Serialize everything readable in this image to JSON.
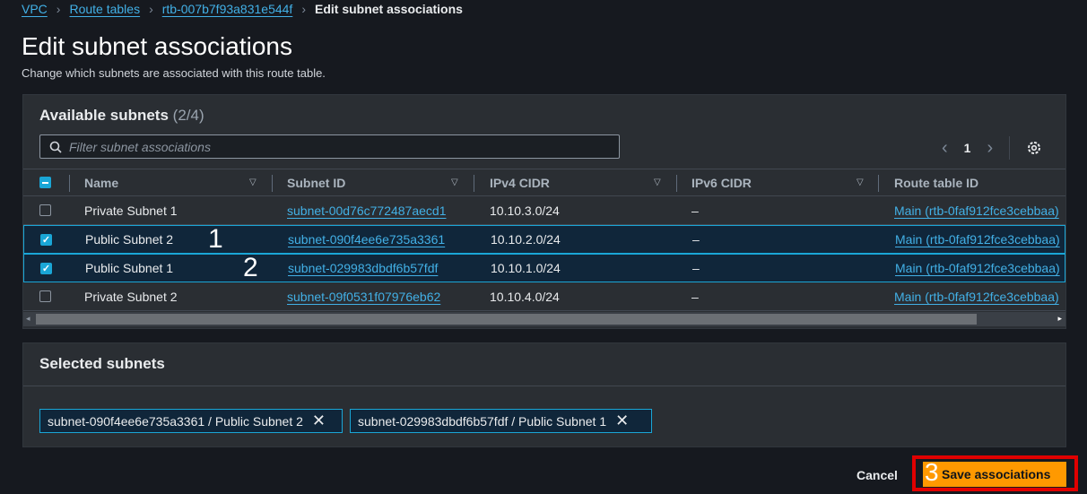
{
  "breadcrumb": [
    {
      "label": "VPC"
    },
    {
      "label": "Route tables"
    },
    {
      "label": "rtb-007b7f93a831e544f"
    },
    {
      "label": "Edit subnet associations"
    }
  ],
  "page": {
    "title": "Edit subnet associations",
    "description": "Change which subnets are associated with this route table."
  },
  "available": {
    "title": "Available subnets",
    "count": "(2/4)",
    "search_placeholder": "Filter subnet associations",
    "page": "1",
    "columns": [
      "Name",
      "Subnet ID",
      "IPv4 CIDR",
      "IPv6 CIDR",
      "Route table ID"
    ],
    "rows": [
      {
        "checked": false,
        "name": "Private Subnet 1",
        "subnet_id": "subnet-00d76c772487aecd1",
        "ipv4": "10.10.3.0/24",
        "ipv6": "–",
        "route_table": "Main (rtb-0faf912fce3cebbaa)"
      },
      {
        "checked": true,
        "name": "Public Subnet 2",
        "subnet_id": "subnet-090f4ee6e735a3361",
        "ipv4": "10.10.2.0/24",
        "ipv6": "–",
        "route_table": "Main (rtb-0faf912fce3cebbaa)"
      },
      {
        "checked": true,
        "name": "Public Subnet 1",
        "subnet_id": "subnet-029983dbdf6b57fdf",
        "ipv4": "10.10.1.0/24",
        "ipv6": "–",
        "route_table": "Main (rtb-0faf912fce3cebbaa)"
      },
      {
        "checked": false,
        "name": "Private Subnet 2",
        "subnet_id": "subnet-09f0531f07976eb62",
        "ipv4": "10.10.4.0/24",
        "ipv6": "–",
        "route_table": "Main (rtb-0faf912fce3cebbaa)"
      }
    ]
  },
  "selected": {
    "title": "Selected subnets",
    "tokens": [
      "subnet-090f4ee6e735a3361 / Public Subnet 2",
      "subnet-029983dbdf6b57fdf / Public Subnet 1"
    ]
  },
  "footer": {
    "cancel": "Cancel",
    "save": "Save associations"
  },
  "annotations": [
    "1",
    "2",
    "3"
  ],
  "colors": {
    "accent": "#1aa6d6",
    "primary_button": "#ff9900",
    "highlight_box": "#e00000"
  }
}
